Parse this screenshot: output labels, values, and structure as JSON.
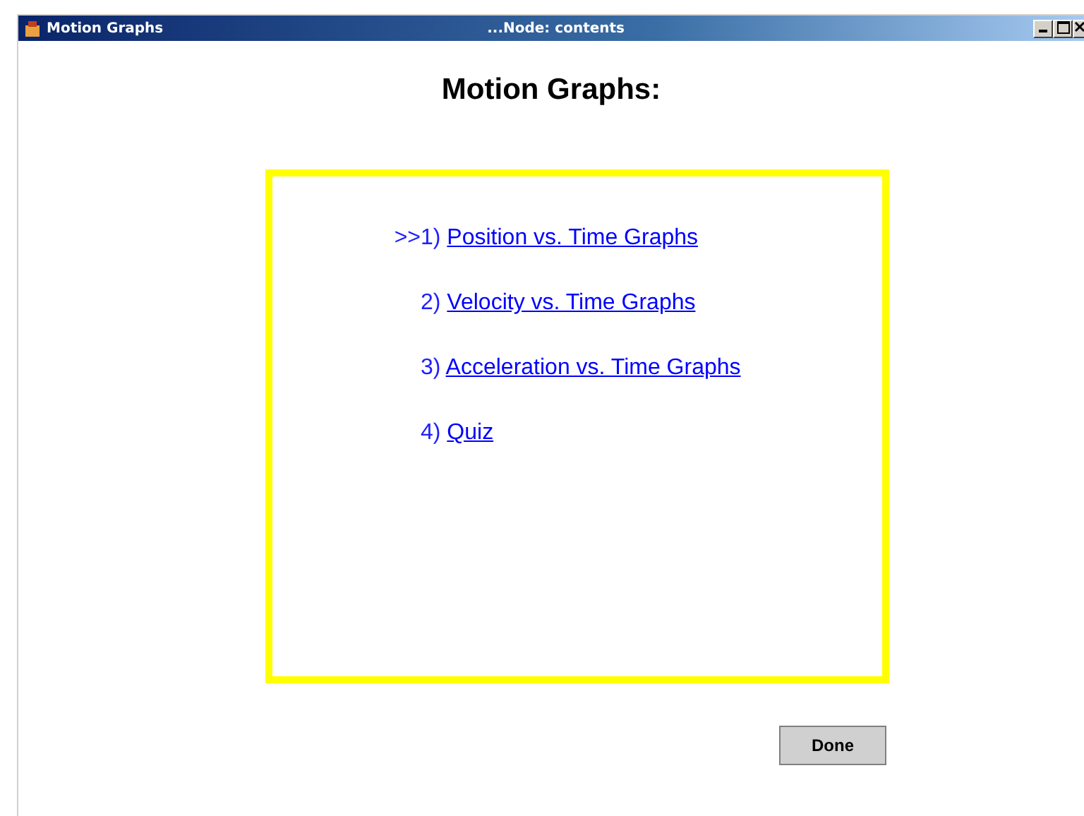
{
  "window": {
    "title": "Motion Graphs",
    "subtitle": "...Node: contents"
  },
  "heading": "Motion Graphs:",
  "items": [
    {
      "marker": ">>",
      "number": "1)",
      "label": "Position vs. Time Graphs"
    },
    {
      "number": "2)",
      "label": "Velocity vs. Time Graphs"
    },
    {
      "number": "3)",
      "label": "Acceleration vs. Time Graphs"
    },
    {
      "number": "4)",
      "label": "Quiz"
    }
  ],
  "buttons": [
    "Done"
  ]
}
